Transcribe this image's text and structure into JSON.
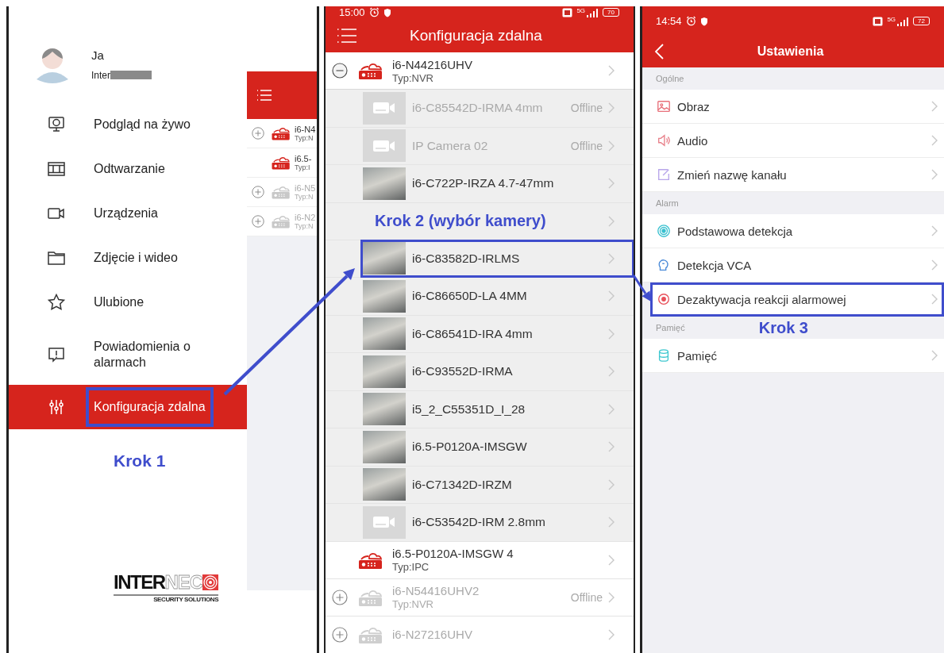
{
  "left_panel": {
    "profile": {
      "name": "Ja",
      "account": "Inter"
    },
    "menu": [
      {
        "label": "Podgląd na żywo",
        "selected": false,
        "highlighted": false
      },
      {
        "label": "Odtwarzanie",
        "selected": false,
        "highlighted": false
      },
      {
        "label": "Urządzenia",
        "selected": false,
        "highlighted": false
      },
      {
        "label": "Zdjęcie i wideo",
        "selected": false,
        "highlighted": false
      },
      {
        "label": "Ulubione",
        "selected": false,
        "highlighted": false
      },
      {
        "label": "Powiadomienia o alarmach",
        "selected": false,
        "highlighted": false
      },
      {
        "label": "Konfiguracja zdalna",
        "selected": true,
        "highlighted": true
      }
    ],
    "annotation": "Krok 1",
    "logo": {
      "bold": "INTER",
      "light": "NEC",
      "tagline": "SECURITY SOLUTIONS"
    },
    "background_list": [
      {
        "expandable": true,
        "online": true,
        "name": "i6-N4",
        "type": "Typ:N"
      },
      {
        "expandable": false,
        "online": true,
        "name": "i6.5-",
        "type": "Typ:I"
      },
      {
        "expandable": true,
        "online": false,
        "name": "i6-N5",
        "type": "Typ:N"
      },
      {
        "expandable": true,
        "online": false,
        "name": "i6-N2",
        "type": "Typ:N"
      }
    ]
  },
  "middle_panel": {
    "status_bar": {
      "time": "15:00",
      "network": "5G",
      "battery": "70"
    },
    "title": "Konfiguracja zdalna",
    "items": [
      {
        "kind": "device",
        "name": "i6-N44216UHV",
        "type": "Typ:NVR",
        "expandable": true,
        "expanded": true,
        "online": true
      },
      {
        "kind": "channel",
        "preview": false,
        "name": "i6-C85542D-IRMA 4mm",
        "online": false,
        "status": "Offline",
        "highlighted": false
      },
      {
        "kind": "channel",
        "preview": false,
        "name": "IP Camera 02",
        "online": false,
        "status": "Offline",
        "highlighted": false
      },
      {
        "kind": "channel",
        "preview": true,
        "name": "i6-C722P-IRZA 4.7-47mm",
        "online": true,
        "highlighted": false
      },
      {
        "kind": "annotation",
        "text": "Krok 2 (wybór kamery)"
      },
      {
        "kind": "channel",
        "preview": true,
        "name": "i6-C83582D-IRLMS",
        "online": true,
        "highlighted": true
      },
      {
        "kind": "channel",
        "preview": true,
        "name": "i6-C86650D-LA 4MM",
        "online": true,
        "highlighted": false
      },
      {
        "kind": "channel",
        "preview": true,
        "name": "i6-C86541D-IRA 4mm",
        "online": true,
        "highlighted": false
      },
      {
        "kind": "channel",
        "preview": true,
        "name": "i6-C93552D-IRMA",
        "online": true,
        "highlighted": false
      },
      {
        "kind": "channel",
        "preview": true,
        "name": "i5_2_C55351D_I_28",
        "online": true,
        "highlighted": false
      },
      {
        "kind": "channel",
        "preview": true,
        "name": "i6.5-P0120A-IMSGW",
        "online": true,
        "highlighted": false
      },
      {
        "kind": "channel",
        "preview": true,
        "name": "i6-C71342D-IRZM",
        "online": true,
        "highlighted": false
      },
      {
        "kind": "channel",
        "preview": false,
        "name": "i6-C53542D-IRM 2.8mm",
        "online": true,
        "highlighted": false
      },
      {
        "kind": "device",
        "name": "i6.5-P0120A-IMSGW 4",
        "type": "Typ:IPC",
        "expandable": false,
        "online": true
      },
      {
        "kind": "device",
        "name": "i6-N54416UHV2",
        "type": "Typ:NVR",
        "expandable": true,
        "expanded": false,
        "online": false,
        "status": "Offline"
      },
      {
        "kind": "device",
        "name": "i6-N27216UHV",
        "expandable": true,
        "expanded": false,
        "online": false
      }
    ]
  },
  "right_panel": {
    "status_bar": {
      "time": "14:54",
      "network": "5G",
      "battery": "72"
    },
    "title": "Ustawienia",
    "sections": [
      {
        "label": "Ogólne",
        "items": [
          {
            "label": "Obraz",
            "highlighted": false
          },
          {
            "label": "Audio",
            "highlighted": false
          },
          {
            "label": "Zmień nazwę kanału",
            "highlighted": false
          }
        ]
      },
      {
        "label": "Alarm",
        "items": [
          {
            "label": "Podstawowa detekcja",
            "highlighted": false
          },
          {
            "label": "Detekcja VCA",
            "highlighted": false
          },
          {
            "label": "Dezaktywacja reakcji alarmowej",
            "highlighted": true
          }
        ]
      },
      {
        "label": "Pamięć",
        "annotation": "Krok 3",
        "items": [
          {
            "label": "Pamięć",
            "highlighted": false
          }
        ]
      }
    ]
  }
}
